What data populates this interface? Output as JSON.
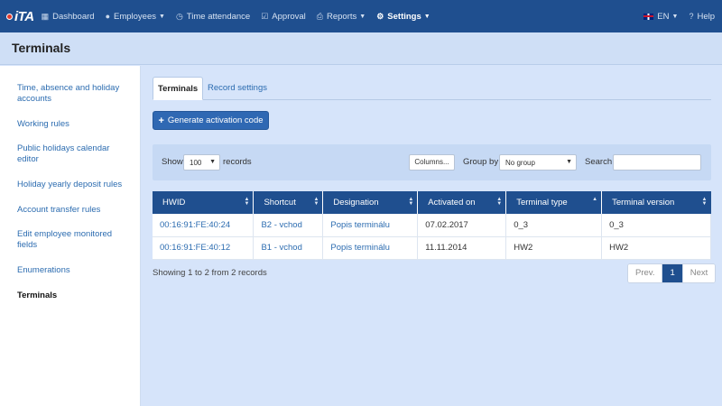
{
  "nav": {
    "logo_text": "iTA",
    "items": [
      {
        "label": "Dashboard",
        "icon": "grid-icon"
      },
      {
        "label": "Employees",
        "icon": "user-icon"
      },
      {
        "label": "Time attendance",
        "icon": "clock-icon"
      },
      {
        "label": "Approval",
        "icon": "check-square-icon"
      },
      {
        "label": "Reports",
        "icon": "printer-icon"
      },
      {
        "label": "Settings",
        "icon": "gear-icon"
      }
    ],
    "language": "EN",
    "help": "Help"
  },
  "page_title": "Terminals",
  "sidebar": {
    "items": [
      {
        "label": "Time, absence and holiday accounts"
      },
      {
        "label": "Working rules"
      },
      {
        "label": "Public holidays calendar editor"
      },
      {
        "label": "Holiday yearly deposit rules"
      },
      {
        "label": "Account transfer rules"
      },
      {
        "label": "Edit employee monitored fields"
      },
      {
        "label": "Enumerations"
      },
      {
        "label": "Terminals"
      }
    ]
  },
  "tabs": [
    {
      "label": "Terminals"
    },
    {
      "label": "Record settings"
    }
  ],
  "generate_button": "Generate activation code",
  "toolbar": {
    "show_label": "Show",
    "show_value": "100",
    "records_label": "records",
    "columns_button": "Columns...",
    "group_by_label": "Group by",
    "group_by_value": "No group",
    "search_label": "Search"
  },
  "table": {
    "headers": [
      "HWID",
      "Shortcut",
      "Designation",
      "Activated on",
      "Terminal type",
      "Terminal version"
    ],
    "rows": [
      [
        "00:16:91:FE:40:24",
        "B2 - vchod",
        "Popis terminálu",
        "07.02.2017",
        "0_3",
        "0_3"
      ],
      [
        "00:16:91:FE:40:12",
        "B1 - vchod",
        "Popis terminálu",
        "11.11.2014",
        "HW2",
        "HW2"
      ]
    ]
  },
  "info": "Showing 1 to 2 from 2 records",
  "pagination": {
    "prev": "Prev.",
    "current": "1",
    "next": "Next"
  },
  "colors": {
    "navbar": "#1f4f8f",
    "accent": "#2f68b3",
    "link": "#2c6cb0"
  }
}
